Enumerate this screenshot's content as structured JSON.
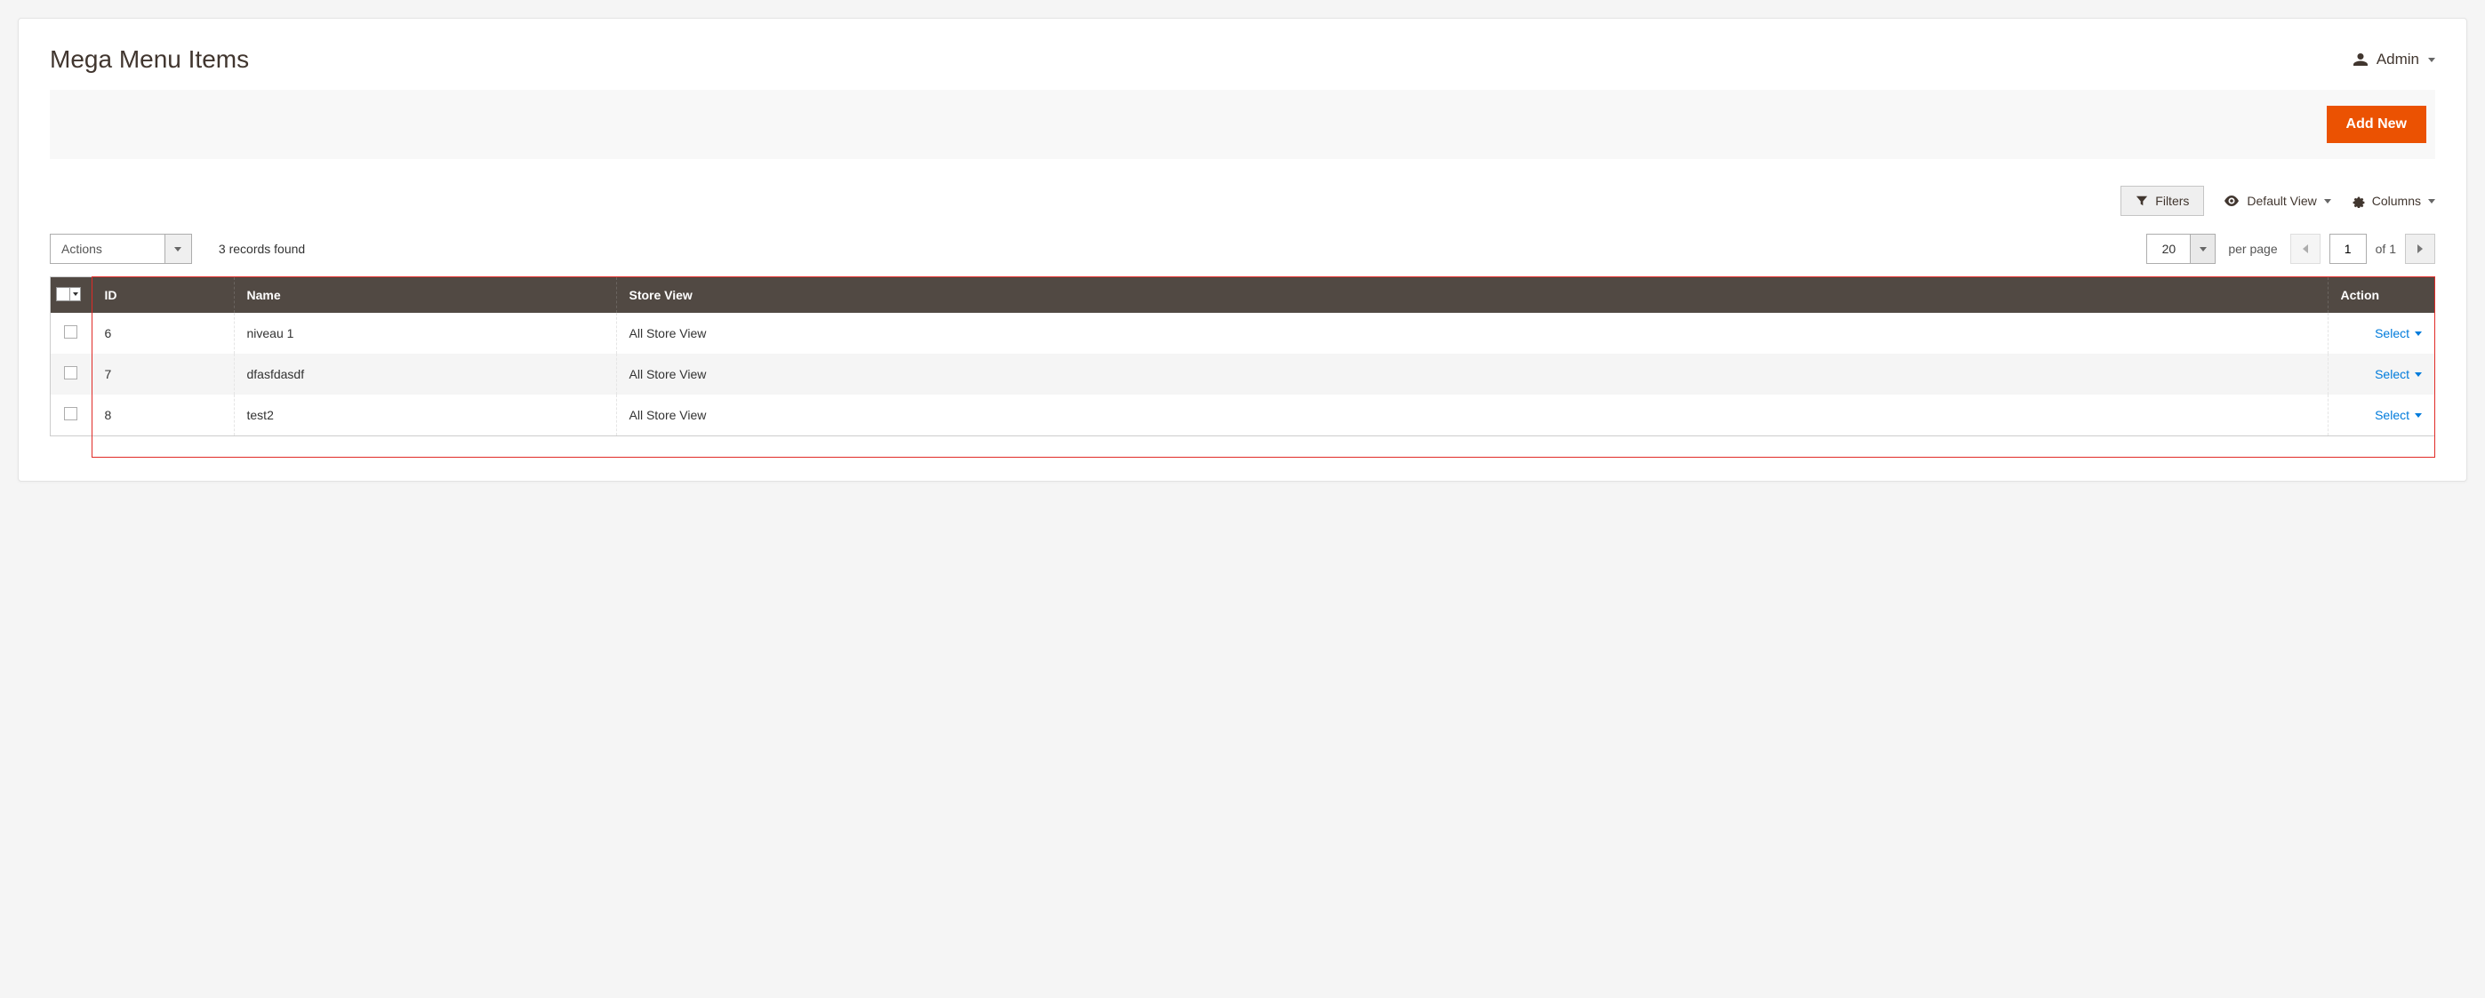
{
  "header": {
    "title": "Mega Menu Items",
    "user_label": "Admin"
  },
  "actions": {
    "add_new": "Add New"
  },
  "toolbar": {
    "filters": "Filters",
    "default_view": "Default View",
    "columns": "Columns"
  },
  "grid_controls": {
    "mass_action_label": "Actions",
    "records_found": "3 records found",
    "per_page_value": "20",
    "per_page_label": "per page",
    "current_page": "1",
    "of_pages": "of 1"
  },
  "table": {
    "columns": {
      "id": "ID",
      "name": "Name",
      "store_view": "Store View",
      "action": "Action"
    },
    "action_label": "Select",
    "rows": [
      {
        "id": "6",
        "name": "niveau 1",
        "store_view": "All Store View"
      },
      {
        "id": "7",
        "name": "dfasfdasdf",
        "store_view": "All Store View"
      },
      {
        "id": "8",
        "name": "test2",
        "store_view": "All Store View"
      }
    ]
  }
}
